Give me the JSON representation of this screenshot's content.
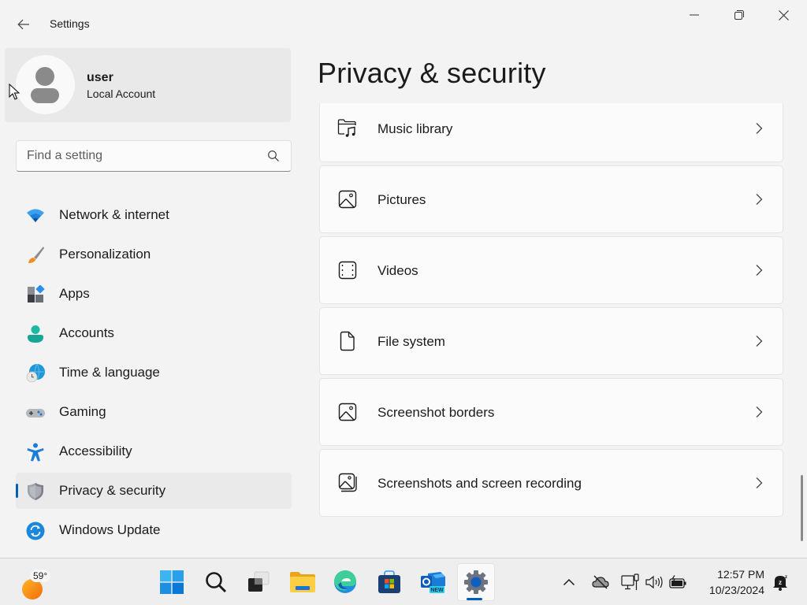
{
  "window": {
    "title": "Settings",
    "controls": {
      "minimize": "minimize",
      "maximize": "restore",
      "close": "close"
    }
  },
  "user": {
    "name": "user",
    "account_type": "Local Account"
  },
  "search": {
    "placeholder": "Find a setting",
    "value": ""
  },
  "sidebar": {
    "items": [
      {
        "label": "Network & internet",
        "icon": "wifi-icon"
      },
      {
        "label": "Personalization",
        "icon": "paintbrush-icon"
      },
      {
        "label": "Apps",
        "icon": "apps-icon"
      },
      {
        "label": "Accounts",
        "icon": "person-icon"
      },
      {
        "label": "Time & language",
        "icon": "globe-clock-icon"
      },
      {
        "label": "Gaming",
        "icon": "gamepad-icon"
      },
      {
        "label": "Accessibility",
        "icon": "accessibility-icon"
      },
      {
        "label": "Privacy & security",
        "icon": "shield-icon",
        "active": true
      },
      {
        "label": "Windows Update",
        "icon": "update-icon"
      }
    ]
  },
  "main": {
    "title": "Privacy & security",
    "items": [
      {
        "label": "Music library",
        "icon": "music-folder-icon"
      },
      {
        "label": "Pictures",
        "icon": "picture-icon"
      },
      {
        "label": "Videos",
        "icon": "video-icon"
      },
      {
        "label": "File system",
        "icon": "file-icon"
      },
      {
        "label": "Screenshot borders",
        "icon": "screenshot-border-icon"
      },
      {
        "label": "Screenshots and screen recording",
        "icon": "screenshots-icon"
      }
    ]
  },
  "taskbar": {
    "weather_temp": "59°",
    "apps": [
      "Start",
      "Search",
      "Task View",
      "File Explorer",
      "Microsoft Edge",
      "Microsoft Store",
      "Outlook (new)",
      "Settings"
    ],
    "outlook_badge": "NEW",
    "time": "12:57 PM",
    "date": "10/23/2024"
  },
  "colors": {
    "accent": "#005fb8",
    "background": "#f3f3f3",
    "card": "#fbfbfb"
  }
}
